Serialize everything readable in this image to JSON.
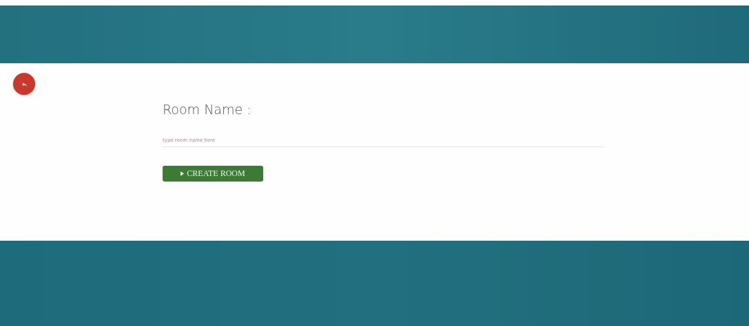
{
  "form": {
    "label": "Room Name :",
    "placeholder": "type room name here",
    "button": "CREATE ROOM"
  }
}
